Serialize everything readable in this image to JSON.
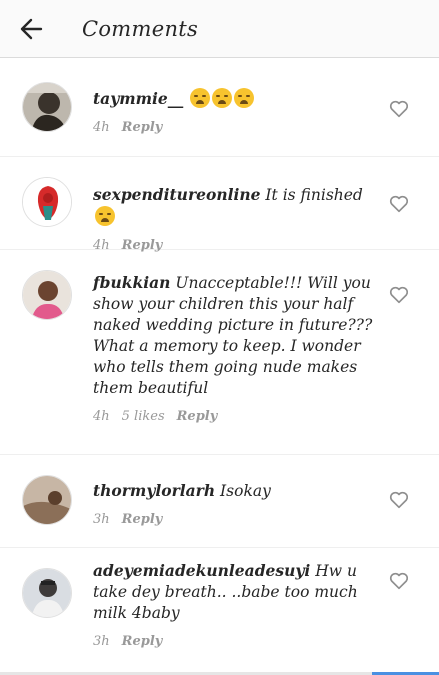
{
  "header": {
    "title": "Comments"
  },
  "comments": [
    {
      "username": "taymmie__",
      "text": "",
      "emoji_count": 3,
      "time": "4h",
      "likes": "",
      "reply": "Reply"
    },
    {
      "username": "sexpenditureonline",
      "text": " It is finished",
      "emoji_count": 1,
      "time": "4h",
      "likes": "",
      "reply": "Reply"
    },
    {
      "username": "fbukkian",
      "text": " Unacceptable!!! Will you show your children this your half naked wedding picture in future??? What a memory to keep. I wonder who tells them going nude makes them beautiful",
      "emoji_count": 0,
      "time": "4h",
      "likes": "5 likes",
      "reply": "Reply"
    },
    {
      "username": "thormylorlarh",
      "text": " Isokay",
      "emoji_count": 0,
      "time": "3h",
      "likes": "",
      "reply": "Reply"
    },
    {
      "username": "adeyemiadekunleadesuyi",
      "text": " Hw u take dey breath.. ..babe too much milk 4baby",
      "emoji_count": 0,
      "time": "3h",
      "likes": "",
      "reply": "Reply"
    }
  ]
}
